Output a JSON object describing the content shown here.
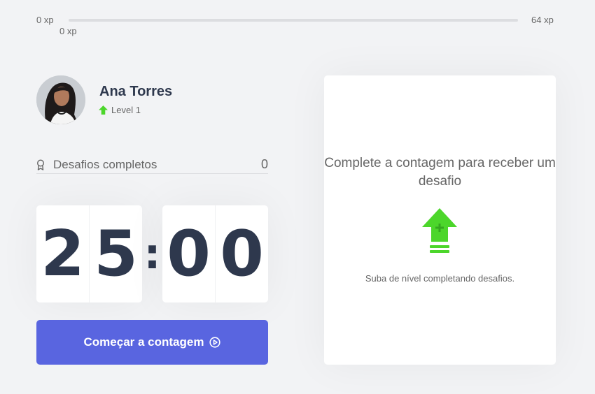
{
  "experience": {
    "min_label": "0 xp",
    "max_label": "64 xp",
    "current_label": "0 xp",
    "progress_fraction": 0
  },
  "profile": {
    "name": "Ana Torres",
    "level_text": "Level 1",
    "avatar_icon": "user-avatar-photo"
  },
  "challenges": {
    "label": "Desafios completos",
    "count": "0",
    "icon": "medal-icon"
  },
  "countdown": {
    "minute_left": "2",
    "minute_right": "5",
    "separator": ":",
    "second_left": "0",
    "second_right": "0"
  },
  "start_button": {
    "label": "Começar a contagem",
    "icon": "play-circle-icon"
  },
  "challenge_card": {
    "title": "Complete a contagem para receber um desafio",
    "icon": "level-up-icon",
    "subtitle": "Suba de nível completando desafios."
  },
  "colors": {
    "background": "#f2f3f5",
    "accent": "#5965e0",
    "green": "#4cd62b",
    "title": "#2e384d",
    "text": "#666666"
  }
}
